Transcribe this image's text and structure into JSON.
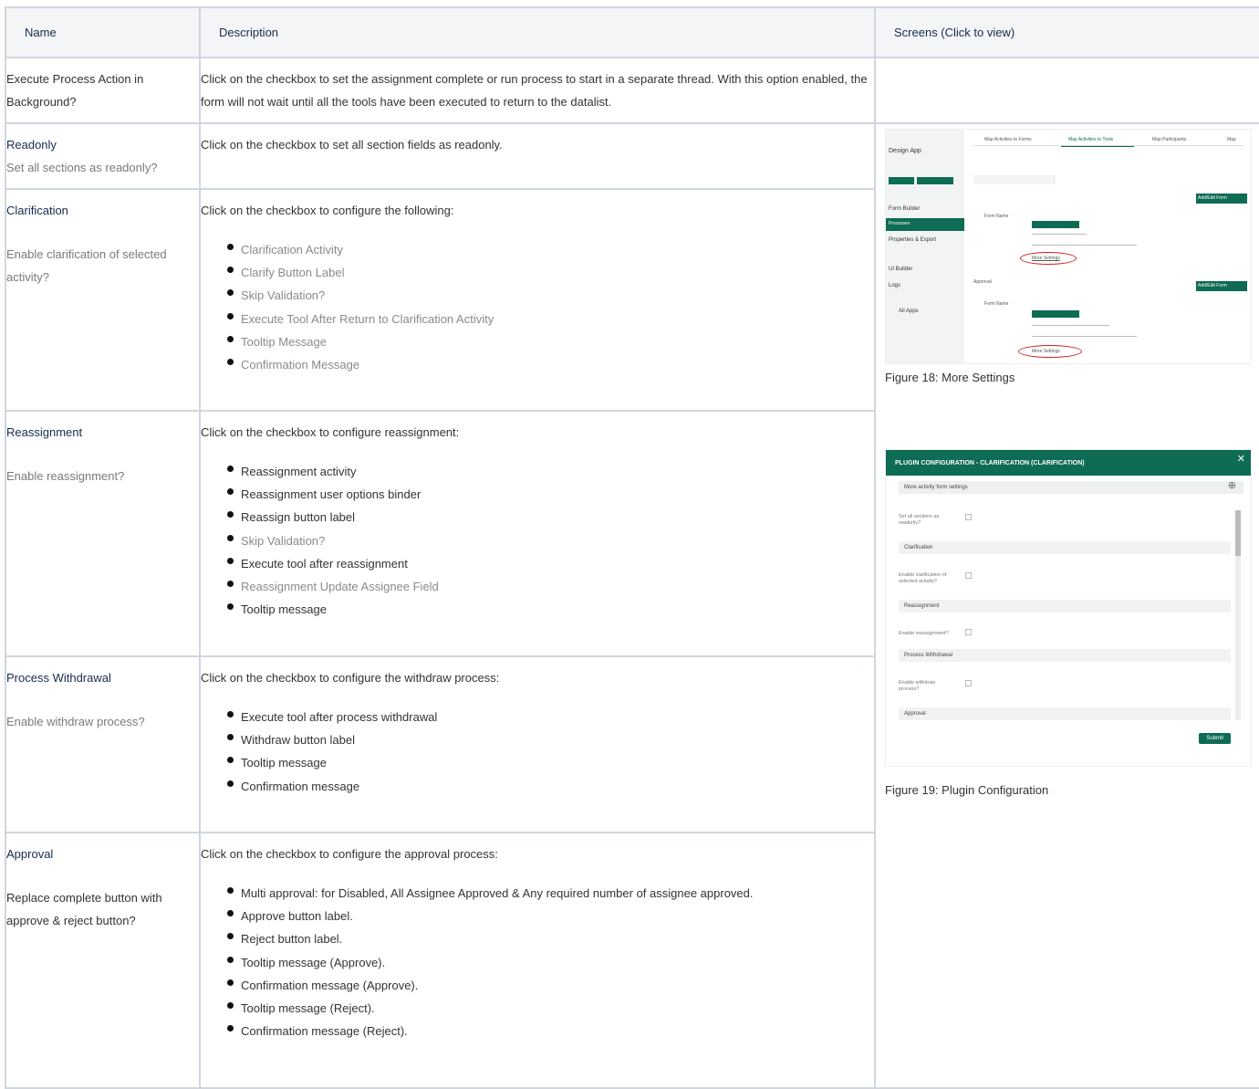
{
  "headers": {
    "name": "Name",
    "description": "Description",
    "screens": "Screens (Click to view)"
  },
  "rows": [
    {
      "name": "Execute Process Action in Background?",
      "description": "Click on the checkbox to set the assignment complete or run process to start in a separate thread. With this option enabled, the form will not wait until all the tools have been executed to return to the datalist."
    },
    {
      "name": "Readonly",
      "sub": "Set all sections as readonly?",
      "description": "Click on the checkbox to set all section fields as readonly."
    },
    {
      "name": "Clarification",
      "sub": "Enable clarification of selected activity?",
      "description": "Click on the checkbox to configure the following:",
      "items": [
        "Clarification Activity",
        "Clarify Button Label",
        "Skip Validation?",
        "Execute Tool After Return to Clarification Activity",
        "Tooltip Message",
        "Confirmation Message"
      ]
    },
    {
      "name": "Reassignment",
      "sub": "Enable reassignment?",
      "description": "Click on the checkbox to configure reassignment:",
      "items": [
        "Reassignment activity",
        "Reassignment user options binder",
        "Reassign button label",
        "Skip Validation?",
        "Execute tool after reassignment",
        "Reassignment Update Assignee Field",
        "Tooltip message"
      ]
    },
    {
      "name": "Process Withdrawal",
      "sub": "Enable withdraw process?",
      "description": "Click on the checkbox to configure the withdraw process:",
      "items": [
        "Execute tool after process withdrawal",
        "Withdraw button label",
        "Tooltip message",
        "Confirmation message"
      ]
    },
    {
      "name": "Approval",
      "sub": "Replace complete button with approve & reject button?",
      "description": "Click on the checkbox to configure the approval process:",
      "items": [
        "Multi approval: for Disabled, All Assignee Approved & Any required number of assignee approved.",
        "Approve button label.",
        "Reject button label.",
        "Tooltip message (Approve).",
        "Confirmation message (Approve).",
        "Tooltip message (Reject).",
        "Confirmation message (Reject)."
      ]
    }
  ],
  "figures": {
    "fig18": {
      "caption": "Figure 18: More Settings",
      "app_title": "Design App",
      "tabs": [
        "Map Activities to Forms",
        "Map Activities to Tools",
        "Map Participants",
        "Map"
      ],
      "sidebar": [
        "Form Builder",
        "Processes",
        "Properties & Export",
        "UI Builder",
        "Logs",
        "All Apps"
      ],
      "buttons": [
        "Add/Edit Form",
        "Add/Edit Form"
      ],
      "labels": [
        "Approval",
        "Form Name",
        "Form Name",
        "More Settings",
        "More Settings"
      ]
    },
    "fig19": {
      "caption": "Figure 19: Plugin Configuration",
      "title": "PLUGIN CONFIGURATION - CLARIFICATION (CLARIFICATION)",
      "section_header": "More activity form settings",
      "fields": [
        "Set all sections as readonly?",
        "Enable clarification of selected activity?",
        "Enable reassignment?",
        "Enable withdraw process?"
      ],
      "sections": [
        "Clarification",
        "Reassignment",
        "Process Withdrawal",
        "Approval"
      ],
      "submit": "Submit"
    }
  }
}
